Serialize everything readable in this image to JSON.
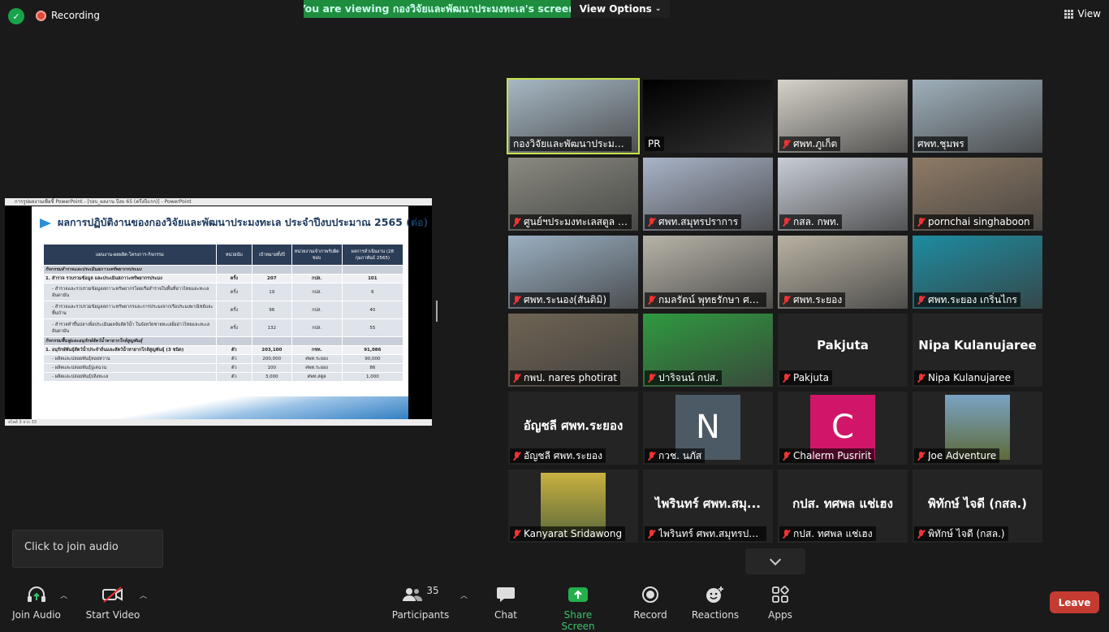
{
  "topbar": {
    "recording_label": "Recording",
    "viewing_banner": "You are viewing กองวิจัยและพัฒนาประมงทะเล's screen",
    "view_options_label": "View Options",
    "view_label": "View"
  },
  "share": {
    "window_title": "การรูปผลงานเพื่อชี้ PowerPoint - [รอบ_ผลงาน ปีงบ 65 (ครึ่งปีแรก)] - PowerPoint",
    "slide_title": "ผลการปฏิบัติงานของกองวิจัยและพัฒนาประมงทะเล ประจำปีงบประมาณ 2565 (ต่อ)",
    "table_headers": [
      "แผนงาน-ผลผลิต-โครงการ-กิจกรรม",
      "หน่วยนับ",
      "เป้าหมายทั้งปี",
      "หน่วยงานเจ้าภาพรับผิดชอบ",
      "ผลการดำเนินงาน (28 กุมภาพันธ์ 2565)"
    ],
    "table_rows": [
      {
        "type": "sec",
        "cells": [
          "กิจกรรมสำรวจและประเมินสภาวะทรัพยากรประมง",
          "",
          "",
          "",
          ""
        ]
      },
      {
        "type": "main",
        "cells": [
          "1. สำรวจ รวบรวมข้อมูล และประเมินสภาวะทรัพยากรประมง",
          "ครั้ง",
          "207",
          "กปส.",
          "101"
        ]
      },
      {
        "type": "tall",
        "cells": [
          "- สำรวจและรวบรวมข้อมูลสภาวะทรัพยากรโดยเรือสำรวจในพื้นที่อ่าวไทยและทะเลอันดามัน",
          "ครั้ง",
          "19",
          "กปส.",
          "6"
        ]
      },
      {
        "type": "tall",
        "cells": [
          "- สำรวจและรวบรวมข้อมูลสภาวะทรัพยากรและการประมงจากเรือประมงพาณิชย์และพื้นบ้าน",
          "ครั้ง",
          "96",
          "กปส.",
          "40"
        ]
      },
      {
        "type": "tall",
        "cells": [
          "- สำรวจทำขึ้นปลาเพื่อประเมินผลจับสัตว์น้ำ ในจังหวัดชายทะเลฝั่งอ่าวไทยและทะเลอันดามัน",
          "ครั้ง",
          "132",
          "กปส.",
          "55"
        ]
      },
      {
        "type": "sec",
        "cells": [
          "กิจกรรมฟื้นฟูและอนุรักษ์สัตว์น้ำหายากใกล้สูญพันธุ์",
          "",
          "",
          "",
          ""
        ]
      },
      {
        "type": "main",
        "cells": [
          "1. อนุรักษ์พันธุ์สัตว์น้ำประจำถิ่นและสัตว์น้ำหายากใกล้สูญพันธุ์ (3 ชนิด)",
          "ตัว",
          "203,100",
          "กชท.",
          "91,086"
        ]
      },
      {
        "type": "row",
        "cells": [
          "- ผลิตและปล่อยพันธุ์หอยหวาน",
          "ตัว",
          "200,000",
          "ศพท.ระยอง",
          "90,000"
        ]
      },
      {
        "type": "row",
        "cells": [
          "- ผลิตและปล่อยพันธุ์ปูเสฉวน",
          "ตัว",
          "100",
          "ศพท.ระยอง",
          "86"
        ]
      },
      {
        "type": "row",
        "cells": [
          "- ผลิตและปล่อยพันธุ์ปลิงทะเล",
          "ตัว",
          "3,000",
          "ศพท.สตูล",
          "1,000"
        ]
      }
    ],
    "status_text": "สไลด์ 3 จาก 33"
  },
  "tiles": [
    {
      "name": "กองวิจัยและพัฒนาประมงทะเล",
      "muted": false,
      "active": true,
      "kind": "video",
      "bg": "#a7b8c4"
    },
    {
      "name": "PR",
      "muted": false,
      "active": false,
      "kind": "video",
      "bg": "#000000"
    },
    {
      "name": "ศพท.ภูเก็ต",
      "muted": true,
      "active": false,
      "kind": "video",
      "bg": "#d6d2c9"
    },
    {
      "name": "ศพท.ชุมพร",
      "muted": false,
      "active": false,
      "kind": "video",
      "bg": "#9fb0bb"
    },
    {
      "name": "ศูนย์ฯประมงทะเลสตูล (นา...",
      "muted": true,
      "active": false,
      "kind": "video",
      "bg": "#8a8a80"
    },
    {
      "name": "ศพท.สมุทรปราการ",
      "muted": true,
      "active": false,
      "kind": "video",
      "bg": "#a9b4c8"
    },
    {
      "name": "กสล. กพท.",
      "muted": true,
      "active": false,
      "kind": "video",
      "bg": "#c8cdd6"
    },
    {
      "name": "pornchai singhaboon",
      "muted": true,
      "active": false,
      "kind": "video",
      "bg": "#8f7b66"
    },
    {
      "name": "ศพท.ระนอง(สันติมิ)",
      "muted": true,
      "active": false,
      "kind": "video",
      "bg": "#9bb0c2"
    },
    {
      "name": "กมลรัตน์ พุทธรักษา ศพท...",
      "muted": true,
      "active": false,
      "kind": "video",
      "bg": "#b7b3a8"
    },
    {
      "name": "ศพท.ระยอง",
      "muted": true,
      "active": false,
      "kind": "video",
      "bg": "#b9b2a3"
    },
    {
      "name": "ศพท.ระยอง เกริ่นไกร",
      "muted": true,
      "active": false,
      "kind": "video",
      "bg": "#1d8ca0"
    },
    {
      "name": "กพป. nares photirat",
      "muted": true,
      "active": false,
      "kind": "video",
      "bg": "#6f6454"
    },
    {
      "name": "ปาริจนน์ กปส.",
      "muted": true,
      "active": false,
      "kind": "video",
      "bg": "#2f9a3f"
    },
    {
      "name": "Pakjuta",
      "muted": true,
      "active": false,
      "kind": "name",
      "big": "Pakjuta"
    },
    {
      "name": "Nipa Kulanujaree",
      "muted": true,
      "active": false,
      "kind": "name",
      "big": "Nipa Kulanujaree"
    },
    {
      "name": "อัญชลี ศพท.ระยอง",
      "muted": true,
      "active": false,
      "kind": "name",
      "big": "อัญชลี ศพท.ระยอง"
    },
    {
      "name": "กวช. นภัส",
      "muted": true,
      "active": false,
      "kind": "letter",
      "letter": "N",
      "bg": "#4c5a66"
    },
    {
      "name": "Chalerm Pusririt",
      "muted": true,
      "active": false,
      "kind": "letter",
      "letter": "C",
      "bg": "#d1166a"
    },
    {
      "name": "Joe Adventure",
      "muted": true,
      "active": false,
      "kind": "avatar",
      "bg": "#7aa3c4"
    },
    {
      "name": "Kanyarat Sridawong",
      "muted": true,
      "active": false,
      "kind": "avatar",
      "bg": "#c9b140"
    },
    {
      "name": "ไพรินทร์ ศพท.สมุทรปรา...",
      "muted": true,
      "active": false,
      "kind": "name",
      "big": "ไพรินทร์ ศพท.สมุ..."
    },
    {
      "name": "กปส. ทศพล แช่เฮง",
      "muted": true,
      "active": false,
      "kind": "name",
      "big": "กปส. ทศพล แช่เฮง"
    },
    {
      "name": "พิทักษ์ ไจดี (กสล.)",
      "muted": true,
      "active": false,
      "kind": "name",
      "big": "พิทักษ์ ไจดี (กสล.)"
    }
  ],
  "tooltip": "Click to join audio",
  "toolbar": {
    "join_audio": "Join Audio",
    "start_video": "Start Video",
    "participants": "Participants",
    "participants_count": "35",
    "chat": "Chat",
    "share_screen": "Share Screen",
    "record": "Record",
    "reactions": "Reactions",
    "apps": "Apps",
    "leave": "Leave"
  },
  "colors": {
    "share_green": "#1e8e3e",
    "active_border": "#c6e14a",
    "leave_red": "#c63b31",
    "muted_red": "#e33333"
  }
}
